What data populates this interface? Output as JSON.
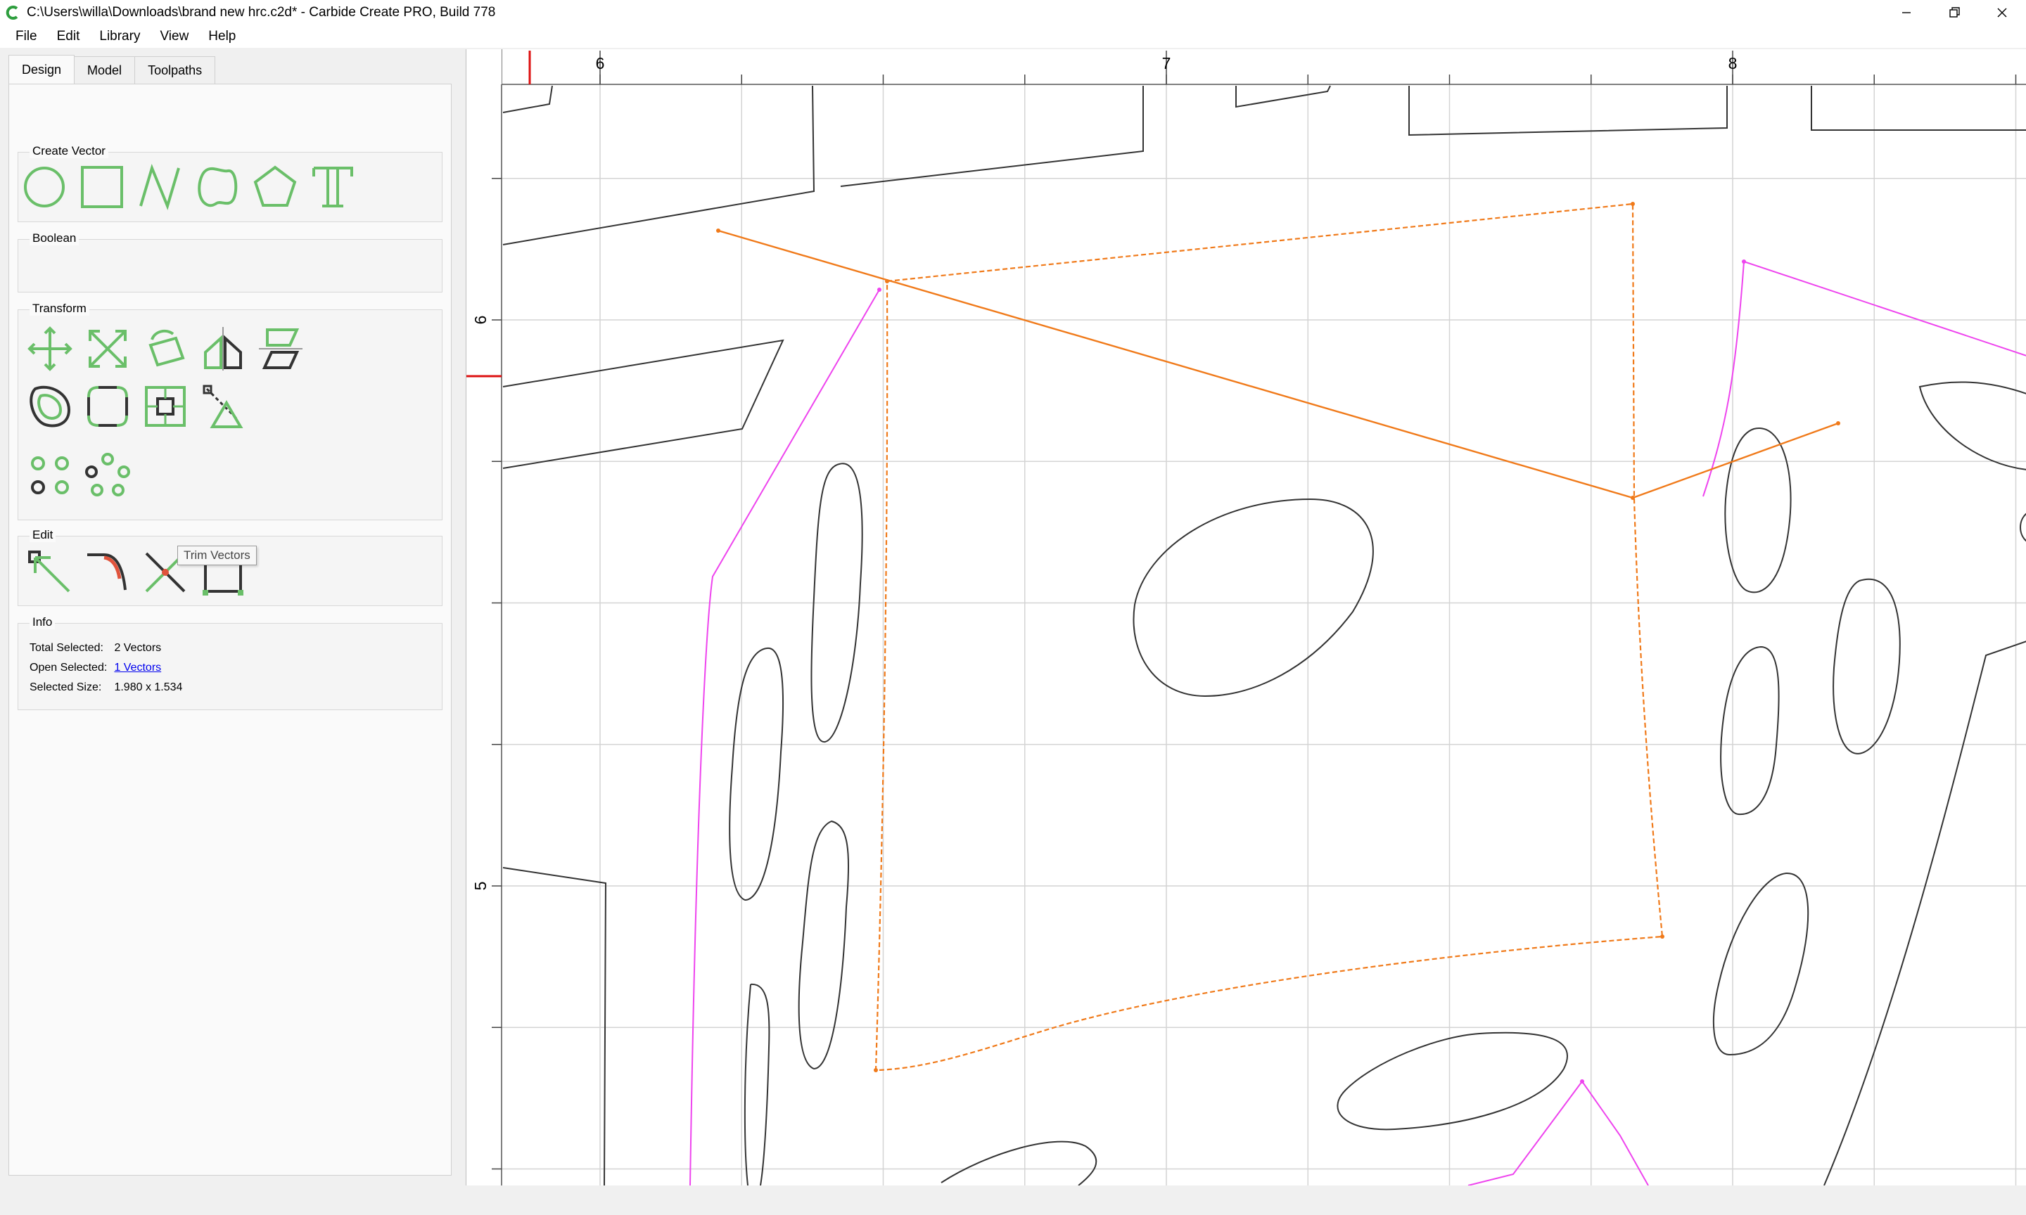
{
  "window": {
    "title": "C:\\Users\\willa\\Downloads\\brand new hrc.c2d* - Carbide Create PRO, Build 778",
    "app_icon": "carbide-c-icon",
    "controls": [
      "minimize-icon",
      "restore-icon",
      "close-icon"
    ]
  },
  "menu": {
    "file": "File",
    "edit": "Edit",
    "library": "Library",
    "view": "View",
    "help": "Help"
  },
  "tabs": {
    "design": "Design",
    "model": "Model",
    "toolpaths": "Toolpaths",
    "active": "Design"
  },
  "groups": {
    "create_vector": "Create Vector",
    "boolean": "Boolean",
    "transform": "Transform",
    "edit": "Edit",
    "info": "Info"
  },
  "tools": {
    "create_vector": [
      "circle-icon",
      "rectangle-icon",
      "polyline-icon",
      "curve-icon",
      "polygon-icon",
      "text-icon"
    ],
    "transform": [
      "move-icon",
      "scale-icon",
      "rotate-icon",
      "mirror-icon",
      "align-icon",
      "offset-icon",
      "fillet-icon",
      "center-icon",
      "scale-to-fit-icon",
      "array-icon",
      "circular-array-icon"
    ],
    "edit": [
      "node-edit-icon",
      "fillet-edit-icon",
      "trim-vectors-icon",
      "bounding-box-icon"
    ]
  },
  "tooltip": "Trim Vectors",
  "info": {
    "total_selected_label": "Total Selected:",
    "total_selected_value": "2 Vectors",
    "open_selected_label": "Open Selected:",
    "open_selected_value": "1 Vectors",
    "selected_size_label": "Selected Size:",
    "selected_size_value": "1.980 x 1.534"
  },
  "canvas": {
    "ruler_x_labels": [
      "6",
      "7",
      "8"
    ],
    "ruler_y_labels": [
      "6",
      "5"
    ],
    "colors": {
      "selected": "#f07a1a",
      "path": "#ee44ee",
      "vector": "#333333",
      "grid": "#d4d4d4",
      "ruler_marker": "#dd1111",
      "accent_green": "#6abf69"
    }
  }
}
